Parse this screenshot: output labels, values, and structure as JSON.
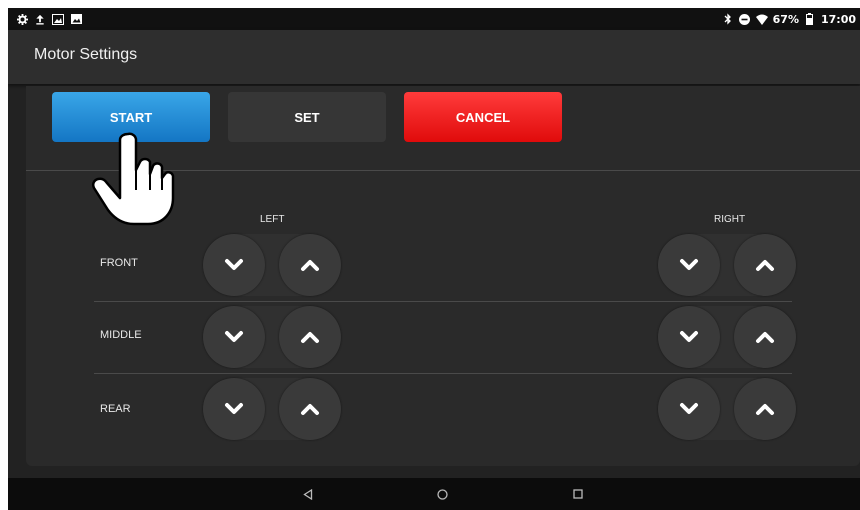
{
  "status_bar": {
    "left_icons": [
      "settings-icon",
      "upload-icon",
      "gallery-icon",
      "image-icon"
    ],
    "bluetooth_icon": "bluetooth-icon",
    "dnd_icon": "do-not-disturb-icon",
    "wifi_icon": "wifi-icon",
    "battery_percent": "67%",
    "battery_icon": "battery-icon",
    "time": "17:00"
  },
  "app_bar": {
    "title": "Motor Settings"
  },
  "actions": {
    "start": "START",
    "set": "SET",
    "cancel": "CANCEL"
  },
  "columns": {
    "left": "LEFT",
    "right": "RIGHT"
  },
  "rows": [
    {
      "label": "FRONT"
    },
    {
      "label": "MIDDLE"
    },
    {
      "label": "REAR"
    }
  ],
  "nav_bar": {
    "back": "back-icon",
    "home": "home-icon",
    "recents": "recents-icon"
  },
  "colors": {
    "start": "#1e88d8",
    "cancel": "#f21c1c",
    "background": "#222222"
  }
}
